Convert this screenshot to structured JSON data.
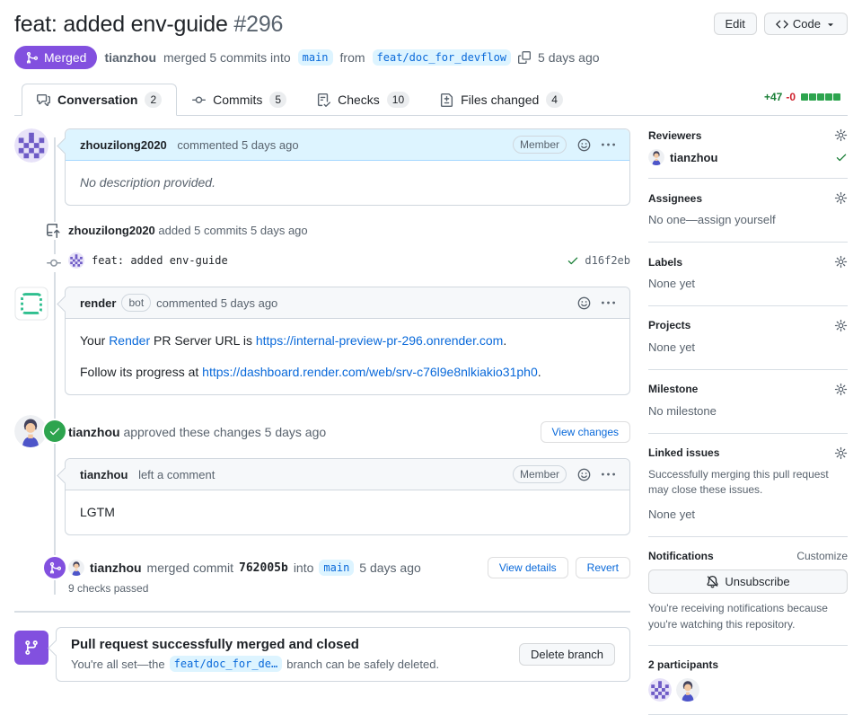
{
  "header": {
    "title": "feat: added env-guide",
    "number": "#296",
    "edit_label": "Edit",
    "code_label": "Code",
    "status_badge": "Merged",
    "merged_by": "tianzhou",
    "merge_text_1": "merged 5 commits into",
    "base_branch": "main",
    "merge_text_2": "from",
    "head_branch": "feat/doc_for_devflow",
    "merge_time": "5 days ago"
  },
  "tabs": [
    {
      "label": "Conversation",
      "count": "2"
    },
    {
      "label": "Commits",
      "count": "5"
    },
    {
      "label": "Checks",
      "count": "10"
    },
    {
      "label": "Files changed",
      "count": "4"
    }
  ],
  "diffstat": {
    "additions": "+47",
    "deletions": "-0"
  },
  "timeline": {
    "comment1": {
      "author": "zhouzilong2020",
      "meta": "commented 5 days ago",
      "badge": "Member",
      "body": "No description provided."
    },
    "commits_event": {
      "author": "zhouzilong2020",
      "meta": "added 5 commits 5 days ago",
      "commit_message": "feat: added env-guide",
      "commit_sha": "d16f2eb"
    },
    "bot_comment": {
      "author": "render",
      "badge": "bot",
      "meta": "commented 5 days ago",
      "p1_pre": "Your ",
      "p1_link1": "Render",
      "p1_mid": " PR Server URL is ",
      "p1_link2": "https://internal-preview-pr-296.onrender.com",
      "p1_post": ".",
      "p2_pre": "Follow its progress at ",
      "p2_link": "https://dashboard.render.com/web/srv-c76l9e8nlkiakio31ph0",
      "p2_post": "."
    },
    "approval": {
      "author": "tianzhou",
      "meta": "approved these changes 5 days ago",
      "button": "View changes"
    },
    "review_comment": {
      "author": "tianzhou",
      "meta": "left a comment",
      "badge": "Member",
      "body": "LGTM"
    },
    "merge_event": {
      "author": "tianzhou",
      "text_pre": "merged commit",
      "sha": "762005b",
      "text_mid": "into",
      "branch": "main",
      "time": "5 days ago",
      "checks": "9 checks passed",
      "details_button": "View details",
      "revert_button": "Revert"
    },
    "merged_banner": {
      "title": "Pull request successfully merged and closed",
      "body_pre": "You're all set—the",
      "branch": "feat/doc_for_de…",
      "body_post": "branch can be safely deleted.",
      "button": "Delete branch"
    }
  },
  "sidebar": {
    "reviewers": {
      "title": "Reviewers",
      "reviewer": "tianzhou"
    },
    "assignees": {
      "title": "Assignees",
      "empty": "No one—assign yourself"
    },
    "labels": {
      "title": "Labels",
      "empty": "None yet"
    },
    "projects": {
      "title": "Projects",
      "empty": "None yet"
    },
    "milestone": {
      "title": "Milestone",
      "empty": "No milestone"
    },
    "linked_issues": {
      "title": "Linked issues",
      "desc": "Successfully merging this pull request may close these issues.",
      "empty": "None yet"
    },
    "notifications": {
      "title": "Notifications",
      "customize": "Customize",
      "button": "Unsubscribe",
      "desc": "You're receiving notifications because you're watching this repository."
    },
    "participants": {
      "title": "2 participants"
    }
  },
  "colors": {
    "merged_purple": "#8250df",
    "success_green": "#2da44e",
    "link_blue": "#0969da",
    "addition_green": "#1a7f37",
    "deletion_red": "#cf222e"
  }
}
